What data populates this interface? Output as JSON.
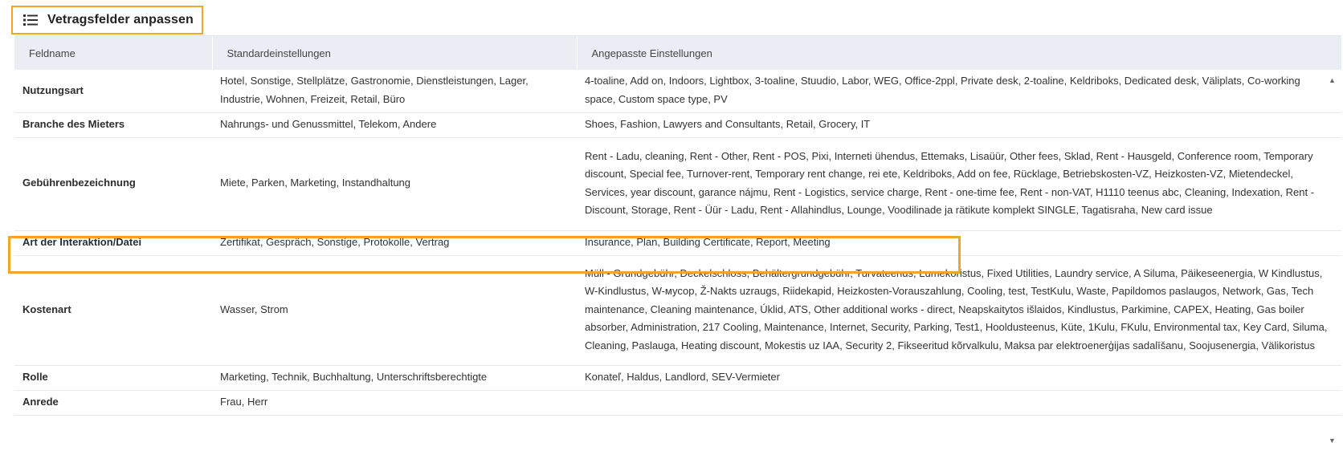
{
  "header": {
    "title": "Vetragsfelder anpassen",
    "icon": "list-icon"
  },
  "table": {
    "columns": [
      "Feldname",
      "Standardeinstellungen",
      "Angepasste Einstellungen"
    ],
    "rows": [
      {
        "name": "Nutzungsart",
        "standard": "Hotel, Sonstige, Stellplätze, Gastronomie, Dienstleistungen, Lager, Industrie, Wohnen, Freizeit, Retail, Büro",
        "custom": "4-toaline, Add on, Indoors, Lightbox, 3-toaline, Stuudio, Labor, WEG, Office-2ppl, Private desk, 2-toaline, Keldriboks, Dedicated desk, Väliplats, Co-working space, Custom space type, PV"
      },
      {
        "name": "Branche des Mieters",
        "standard": "Nahrungs- und Genussmittel, Telekom, Andere",
        "custom": "Shoes, Fashion, Lawyers and Consultants, Retail, Grocery, IT"
      },
      {
        "name": "Gebührenbezeichnung",
        "standard": "Miete, Parken, Marketing, Instandhaltung",
        "custom": "Rent - Ladu, cleaning, Rent - Other, Rent - POS, Pixi, Interneti ühendus, Ettemaks, Lisaüür, Other fees, Sklad, Rent - Hausgeld, Conference room, Temporary discount, Special fee, Turnover-rent, Temporary rent change, rei ete, Keldriboks, Add on fee, Rücklage, Betriebskosten-VZ, Heizkosten-VZ, Mietendeckel, Services, year discount, garance nájmu, Rent - Logistics, service charge, Rent - one-time fee, Rent - non-VAT, H1110 teenus abc, Cleaning, Indexation, Rent - Discount, Storage, Rent - Üür - Ladu, Rent - Allahindlus, Lounge, Voodilinade ja rätikute komplekt SINGLE, Tagatisraha, New card issue"
      },
      {
        "name": "Art der Interaktion/Datei",
        "standard": "Zertifikat, Gespräch, Sonstige, Protokolle, Vertrag",
        "custom": "Insurance, Plan, Building Certificate, Report, Meeting"
      },
      {
        "name": "Kostenart",
        "standard": "Wasser, Strom",
        "custom": "Müll - Grundgebühr, Deckelschloss, Behältergrundgebühr, Turvateenus, Lumekoristus, Fixed Utilities, Laundry service, A Siluma, Päikeseenergia, W Kindlustus, W-Kindlustus, W-мусор, Ž-Nakts uzraugs, Riidekapid, Heizkosten-Vorauszahlung, Cooling, test, TestKulu, Waste, Papildomos paslaugos, Network, Gas, Tech maintenance, Cleaning maintenance, Úklid, ATS, Other additional works - direct, Neapskaitytos išlaidos, Kindlustus, Parkimine, CAPEX, Heating, Gas boiler absorber, Administration, 217 Cooling, Maintenance, Internet, Security, Parking, Test1, Hooldusteenus, Küte, 1Kulu, FKulu, Environmental tax, Key Card, Siluma, Cleaning, Paslauga, Heating discount, Mokestis uz IAA, Security 2, Fikseeritud kõrvalkulu, Maksa par elektroenerģijas sadalīšanu, Soojusenergia, Välikoristus"
      },
      {
        "name": "Rolle",
        "standard": "Marketing, Technik, Buchhaltung, Unterschriftsberechtigte",
        "custom": "Konateľ, Haldus, Landlord, SEV-Vermieter"
      },
      {
        "name": "Anrede",
        "standard": "Frau, Herr",
        "custom": ""
      }
    ]
  },
  "scrollbar": {
    "up_icon": "▲",
    "down_icon": "▼"
  },
  "colors": {
    "highlight": "#f2a626",
    "header_bg": "#eaedf4"
  }
}
